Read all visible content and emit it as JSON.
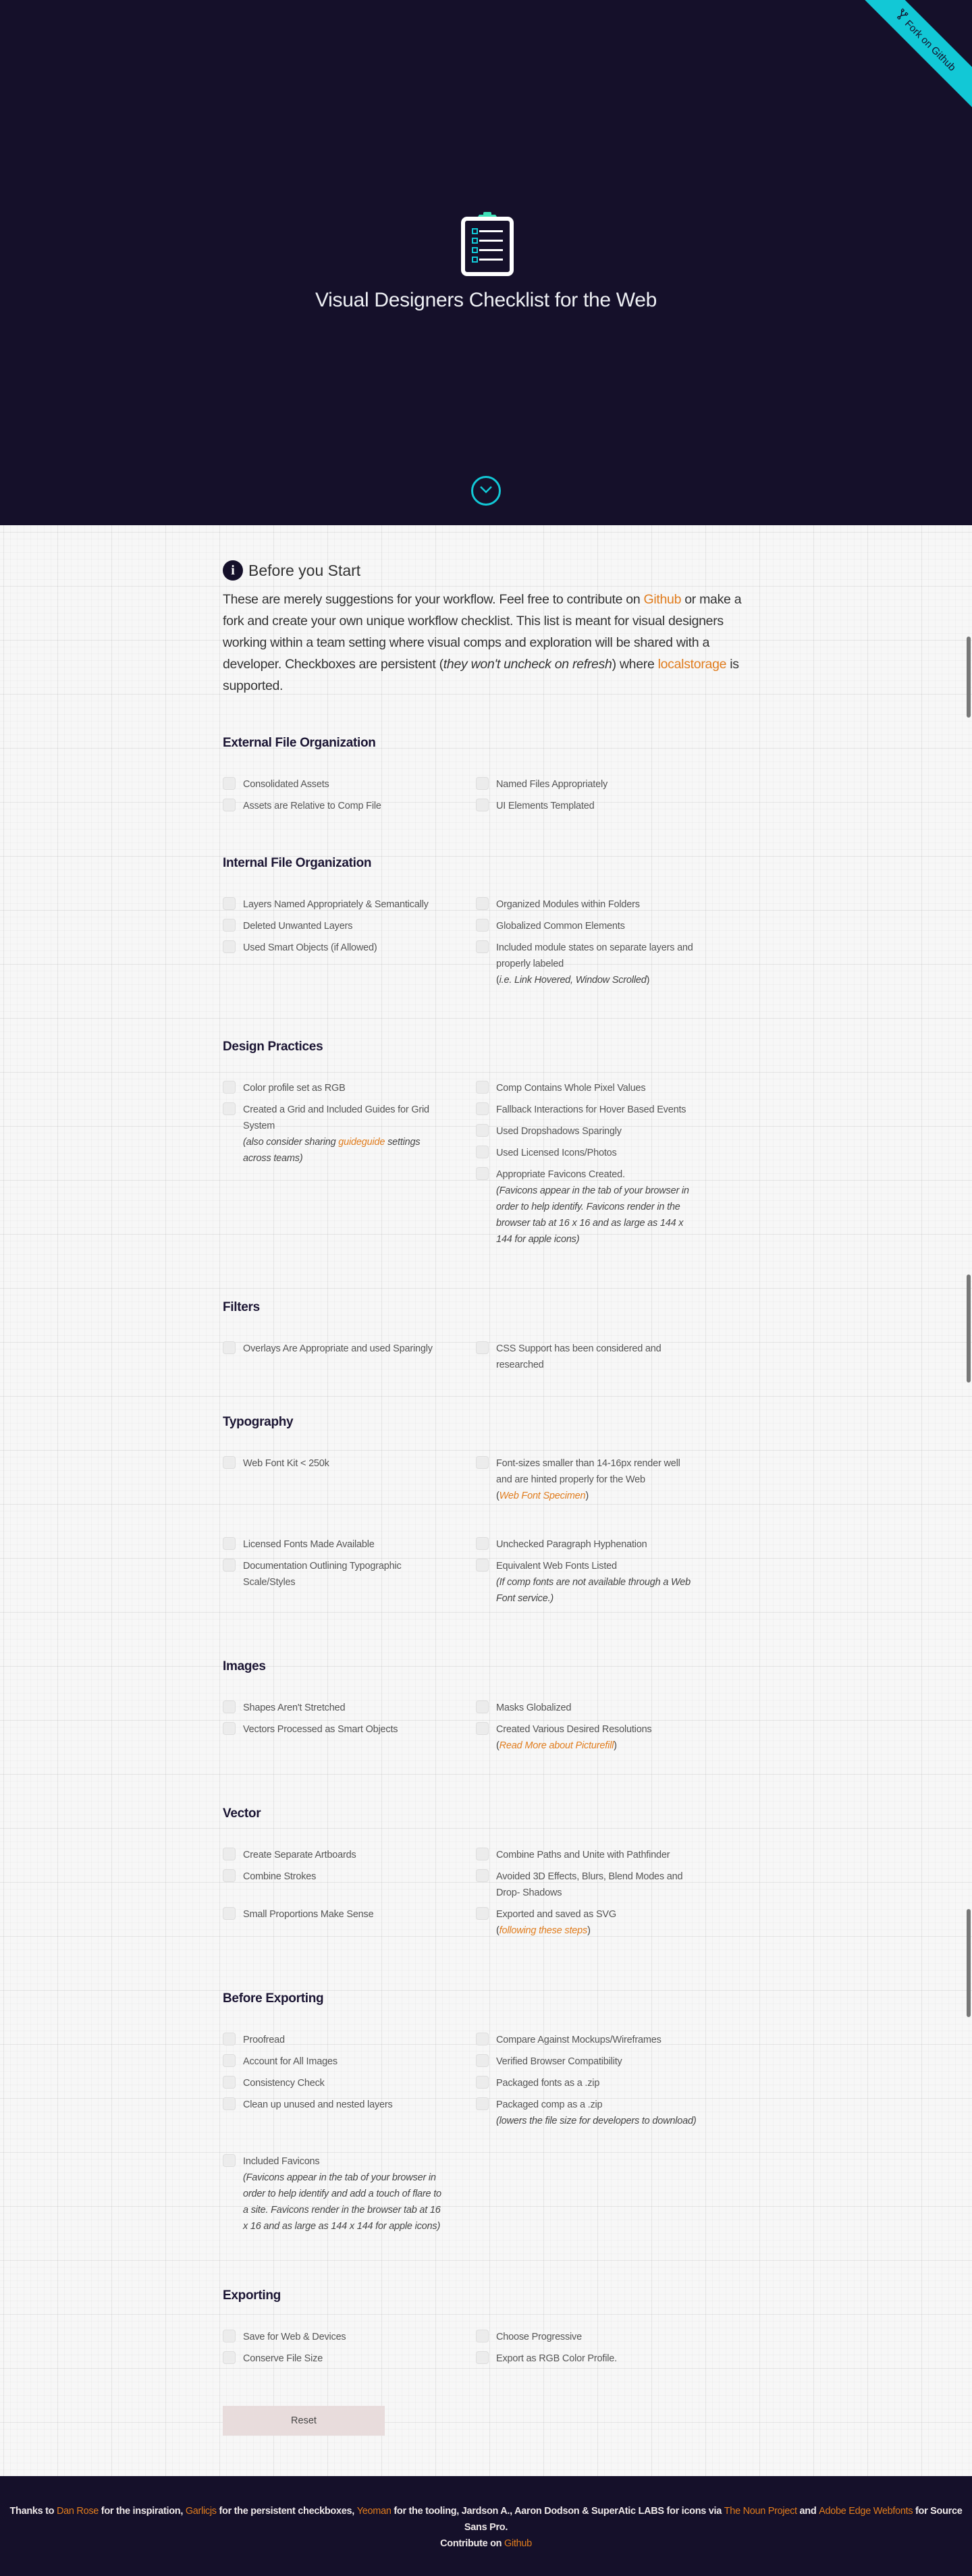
{
  "hero": {
    "title": "Visual Designers Checklist for the Web",
    "ribbon_label": "Fork on Github",
    "ribbon_icon": "fork-icon",
    "logo_icon": "clipboard-checklist-icon",
    "scroll_icon": "chevron-down-circle-icon",
    "colors": {
      "background": "#15102a",
      "accent": "#12c8d6",
      "clip": "#3fe0b8"
    }
  },
  "intro": {
    "heading": "Before you Start",
    "icon": "info-icon",
    "text_1": "These are merely suggestions for your workflow. Feel free to contribute on ",
    "link_github": "Github",
    "text_2": " or make a fork and create your own unique workflow checklist. This list is meant for visual designers working within a team setting where visual comps and exploration will be shared with a developer. Checkboxes are persistent (",
    "emphasis": "they won't uncheck on refresh",
    "text_3": ") where ",
    "link_localstorage": "localstorage",
    "text_4": " is supported."
  },
  "sections": {
    "external": {
      "title": "External File Organization",
      "items": [
        "Consolidated Assets",
        "Assets are Relative to Comp File",
        "Named Files Appropriately",
        "UI Elements Templated"
      ]
    },
    "internal": {
      "title": "Internal File Organization",
      "items": [
        "Layers Named Appropriately & Semantically",
        "Deleted Unwanted Layers",
        "Used Smart Objects (if Allowed)",
        "Organized Modules within Folders",
        "Globalized Common Elements",
        "Included module states on separate layers and properly labeled"
      ],
      "note_open": "(",
      "note_ie": "i.e. Link Hovered, Window Scrolled",
      "note_close": ")"
    },
    "design": {
      "title": "Design Practices",
      "items": [
        "Color profile set as RGB",
        "Created a Grid and Included Guides for Grid System",
        "Comp Contains Whole Pixel Values",
        "Fallback Interactions for Hover Based Events",
        "Used Dropshadows Sparingly",
        "Used Licensed Icons/Photos",
        "Appropriate Favicons Created."
      ],
      "grid_note_1": "also consider sharing ",
      "grid_note_link": "guideguide",
      "grid_note_2": " settings across teams",
      "favicon_note": "Favicons appear in the tab of your browser in order to help identify. Favicons render in the browser tab at 16 x 16 and as large as 144 x 144 for apple icons"
    },
    "filters": {
      "title": "Filters",
      "items": [
        "Overlays Are Appropriate and used Sparingly",
        "CSS Support has been considered and researched"
      ]
    },
    "typography": {
      "title": "Typography",
      "items": [
        "Web Font Kit < 250k",
        "Licensed Fonts Made Available",
        "Documentation Outlining Typographic Scale/Styles",
        "Font-sizes smaller than 14-16px render well and are hinted properly for the Web",
        "Unchecked Paragraph Hyphenation",
        "Equivalent Web Fonts Listed"
      ],
      "specimen_link": "Web Font Specimen",
      "equiv_note": "If comp fonts are not available through a Web Font service."
    },
    "images": {
      "title": "Images",
      "items": [
        "Shapes Aren't Stretched",
        "Vectors Processed as Smart Objects",
        "Masks Globalized",
        "Created Various Desired Resolutions"
      ],
      "picturefill_link": "Read More about Picturefill"
    },
    "vector": {
      "title": "Vector",
      "items": [
        "Create Separate Artboards",
        "Combine Strokes",
        "Small Proportions Make Sense",
        "Combine Paths and Unite with Pathfinder",
        "Avoided 3D Effects, Blurs, Blend Modes and Drop- Shadows",
        "Exported and saved as SVG"
      ],
      "steps_link": "following these steps"
    },
    "before_exporting": {
      "title": "Before Exporting",
      "items": [
        "Proofread",
        "Account for All Images",
        "Consistency Check",
        "Clean up unused and nested layers",
        "Included Favicons",
        "Compare Against Mockups/Wireframes",
        "Verified Browser Compatibility",
        "Packaged fonts as a .zip",
        "Packaged comp as a .zip"
      ],
      "favicon_note": "Favicons appear in the tab of your browser in order to help identify and add a touch of flare to a site. Favicons render in the browser tab at 16 x 16 and as large as 144 x 144 for apple icons",
      "zip_note": "lowers the file size for developers to download"
    },
    "exporting": {
      "title": "Exporting",
      "items": [
        "Save for Web & Devices",
        "Conserve File Size",
        "Choose Progressive",
        "Export as RGB Color Profile."
      ]
    }
  },
  "reset_label": "Reset",
  "footer": {
    "t1": "Thanks to ",
    "l1": "Dan Rose",
    "t2": " for the inspiration, ",
    "l2": "Garlicjs",
    "t3": " for the persistent checkboxes, ",
    "l3": "Yeoman",
    "t4": " for the tooling, Jardson A., Aaron Dodson & SuperAtic LABS for icons via ",
    "l4": "The Noun Project",
    "t5": " and ",
    "l5": "Adobe Edge Webfonts",
    "t6": " for Source Sans Pro.",
    "t7": "Contribute on ",
    "l6": "Github"
  },
  "colors": {
    "link": "#e07c1d",
    "heading": "#1b1533",
    "checkbox": "#ececec",
    "reset_button": "#e8dcdc"
  }
}
